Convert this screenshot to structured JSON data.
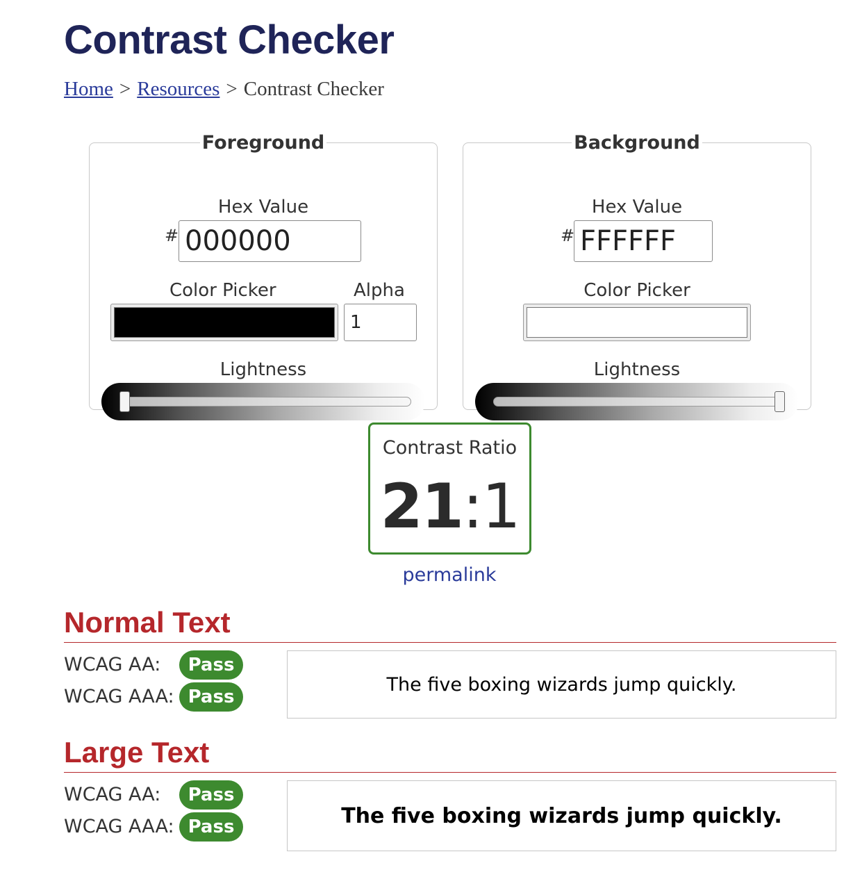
{
  "page": {
    "title": "Contrast Checker"
  },
  "breadcrumb": {
    "items": [
      {
        "label": "Home",
        "link": true
      },
      {
        "label": "Resources",
        "link": true
      },
      {
        "label": "Contrast Checker",
        "link": false
      }
    ],
    "separator": ">"
  },
  "foreground": {
    "legend": "Foreground",
    "hex_label": "Hex Value",
    "hash": "#",
    "hex_value": "000000",
    "picker_label": "Color Picker",
    "picker_color": "#000000",
    "alpha_label": "Alpha",
    "alpha_value": "1",
    "lightness_label": "Lightness",
    "lightness": 0
  },
  "background": {
    "legend": "Background",
    "hex_label": "Hex Value",
    "hash": "#",
    "hex_value": "FFFFFF",
    "picker_label": "Color Picker",
    "picker_color": "#FFFFFF",
    "lightness_label": "Lightness",
    "lightness": 1
  },
  "contrast": {
    "label": "Contrast Ratio",
    "ratio_major": "21",
    "ratio_sep": ":",
    "ratio_minor": "1",
    "permalink": "permalink"
  },
  "normal_text": {
    "title": "Normal Text",
    "aa_label": "WCAG AA:",
    "aa_result": "Pass",
    "aaa_label": "WCAG AAA:",
    "aaa_result": "Pass",
    "sample": "The five boxing wizards jump quickly."
  },
  "large_text": {
    "title": "Large Text",
    "aa_label": "WCAG AA:",
    "aa_result": "Pass",
    "aaa_label": "WCAG AAA:",
    "aaa_result": "Pass",
    "sample": "The five boxing wizards jump quickly."
  },
  "colors": {
    "title": "#1f2458",
    "link": "#2a3b9a",
    "section": "#b5272b",
    "pass": "#3d8a2f"
  }
}
